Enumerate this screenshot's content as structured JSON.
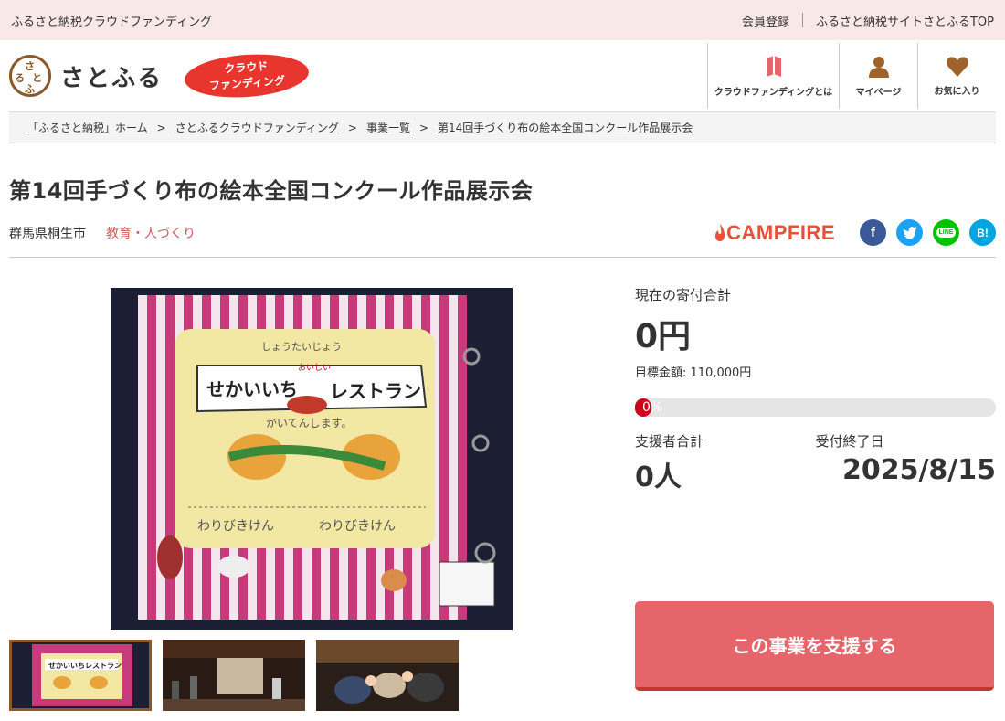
{
  "topbar": {
    "site_label": "ふるさと納税クラウドファンディング",
    "register": "会員登録",
    "satofull_top": "ふるさと納税サイトさとふるTOP"
  },
  "header": {
    "logo_text": "さとふる",
    "logo_mark_chars": [
      "さ",
      "と",
      "ふ",
      "る"
    ],
    "badge_line1": "クラウド",
    "badge_line2": "ファンディング",
    "nav": [
      {
        "label": "クラウドファンディングとは",
        "icon": "book-icon"
      },
      {
        "label": "マイページ",
        "icon": "user-icon"
      },
      {
        "label": "お気に入り",
        "icon": "heart-icon"
      }
    ]
  },
  "breadcrumb": [
    "「ふるさと納税」ホーム",
    "さとふるクラウドファンディング",
    "事業一覧",
    "第14回手づくり布の絵本全国コンクール作品展示会"
  ],
  "breadcrumb_sep": ">",
  "project": {
    "title": "第14回手づくり布の絵本全国コンクール作品展示会",
    "location": "群馬県桐生市",
    "category": "教育・人づくり"
  },
  "share": {
    "campfire": "CAMPFIRE",
    "facebook": "f",
    "twitter": "t",
    "line": "LINE",
    "hatena": "B!"
  },
  "funding": {
    "current_label": "現在の寄付合計",
    "current_amount": "0円",
    "target": "目標金額: 110,000円",
    "progress_text": "0%",
    "progress_value": 0,
    "supporters_label": "支援者合計",
    "supporters_value": "0人",
    "deadline_label": "受付終了日",
    "deadline_value": "2025/8/15",
    "support_button": "この事業を支援する"
  },
  "image_text": {
    "main_line1": "しょうたいじょう",
    "main_line2": "せかいいち",
    "main_line3": "おいしい",
    "main_line4": "レストラン",
    "main_line5": "かいてんします。",
    "main_line6": "わりびきけん",
    "thumb_label": "せかいいちレストラン"
  },
  "colors": {
    "topbar_bg": "#f8e8e8",
    "accent_red": "#e8352d",
    "support_button": "#e5656a",
    "category": "#d05a5a",
    "facebook": "#3b5998",
    "twitter": "#1da1f2",
    "line": "#00c300",
    "hatena": "#00a4de"
  }
}
